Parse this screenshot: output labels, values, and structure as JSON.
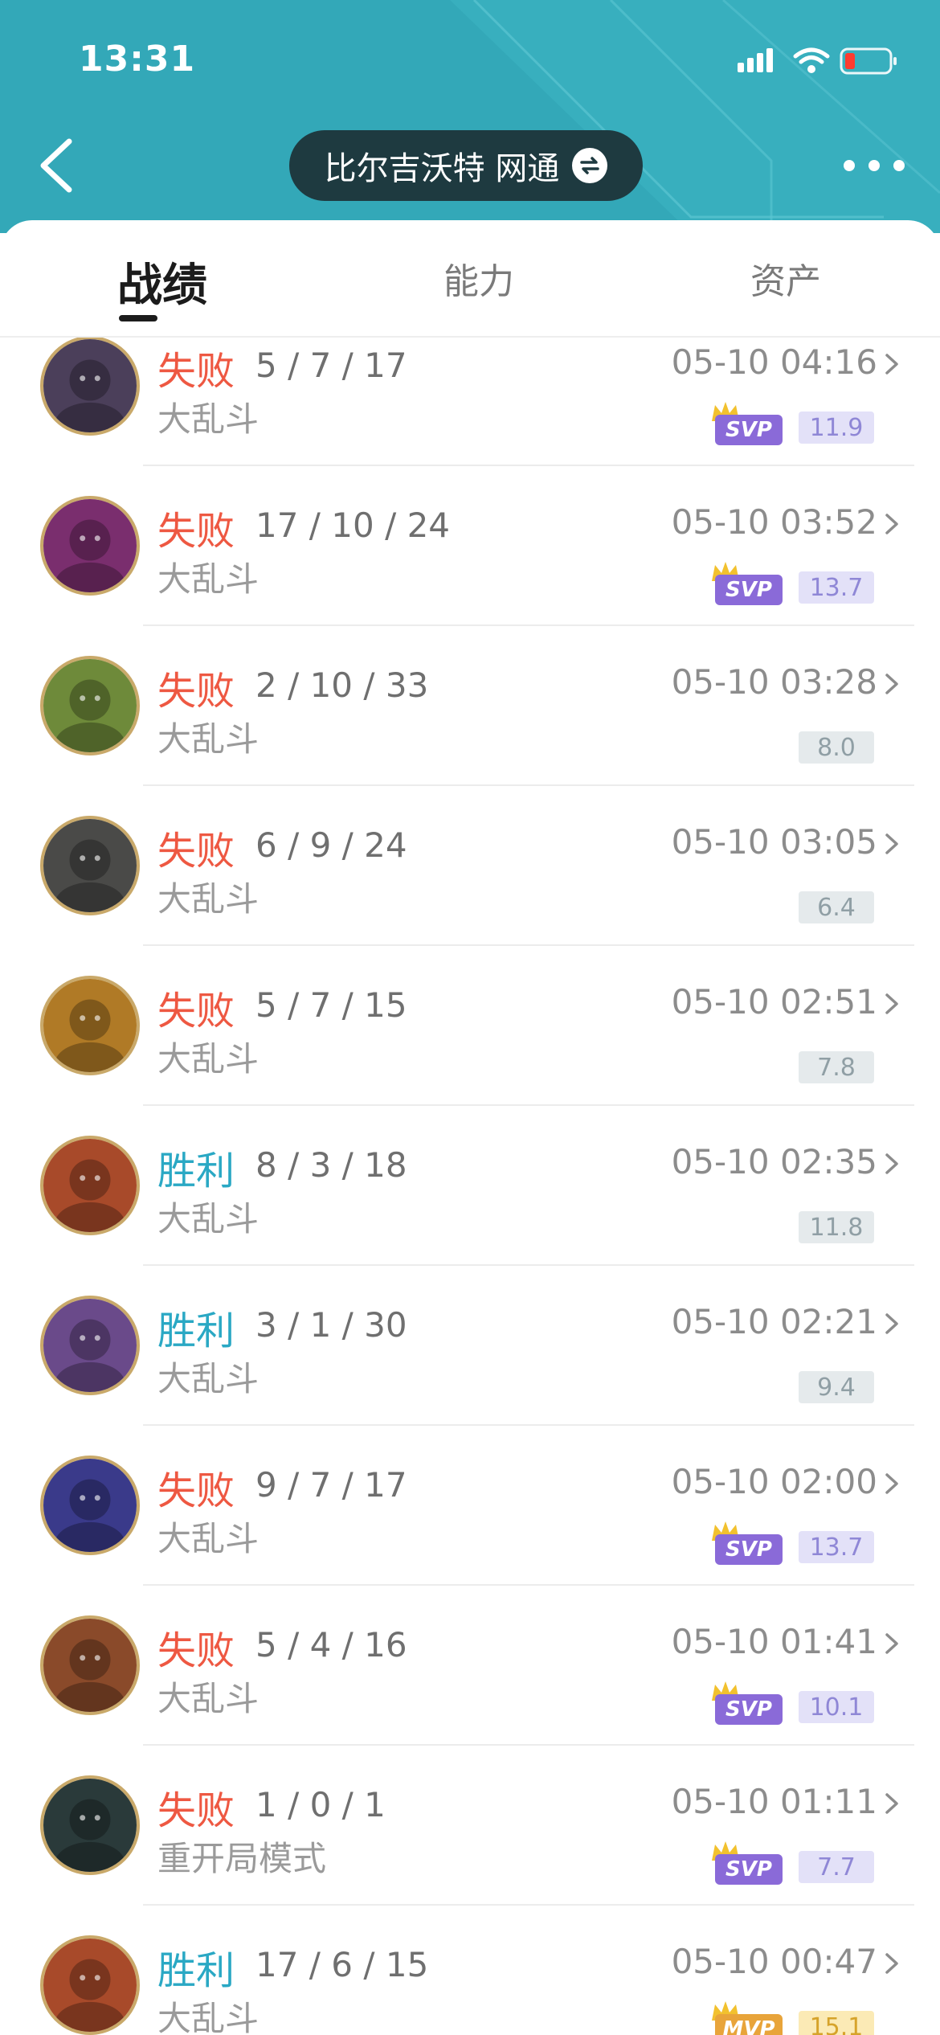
{
  "status_bar": {
    "time": "13:31"
  },
  "header": {
    "server": "比尔吉沃特 网通",
    "colors": {
      "bg": "#33a8b8",
      "pill": "#1e3a40"
    }
  },
  "tabs": [
    {
      "label": "战绩",
      "active": true
    },
    {
      "label": "能力",
      "active": false
    },
    {
      "label": "资产",
      "active": false
    }
  ],
  "colors": {
    "lose": "#ee5842",
    "win": "#2aa8c4"
  },
  "matches": [
    {
      "result": "失败",
      "outcome": "lose",
      "kda": "5 / 7 / 17",
      "mode": "大乱斗",
      "time": "05-10 04:16",
      "badge": "SVP",
      "score": "11.9",
      "avatar_color": "#4b3f5a",
      "avatar_icon": "champion-portrait"
    },
    {
      "result": "失败",
      "outcome": "lose",
      "kda": "17 / 10 / 24",
      "mode": "大乱斗",
      "time": "05-10 03:52",
      "badge": "SVP",
      "score": "13.7",
      "avatar_color": "#7a2e6e",
      "avatar_icon": "champion-portrait"
    },
    {
      "result": "失败",
      "outcome": "lose",
      "kda": "2 / 10 / 33",
      "mode": "大乱斗",
      "time": "05-10 03:28",
      "badge": "",
      "score": "8.0",
      "avatar_color": "#6e8a3a",
      "avatar_icon": "champion-portrait"
    },
    {
      "result": "失败",
      "outcome": "lose",
      "kda": "6 / 9 / 24",
      "mode": "大乱斗",
      "time": "05-10 03:05",
      "badge": "",
      "score": "6.4",
      "avatar_color": "#4a4a48",
      "avatar_icon": "champion-portrait"
    },
    {
      "result": "失败",
      "outcome": "lose",
      "kda": "5 / 7 / 15",
      "mode": "大乱斗",
      "time": "05-10 02:51",
      "badge": "",
      "score": "7.8",
      "avatar_color": "#b07a26",
      "avatar_icon": "champion-portrait"
    },
    {
      "result": "胜利",
      "outcome": "win",
      "kda": "8 / 3 / 18",
      "mode": "大乱斗",
      "time": "05-10 02:35",
      "badge": "",
      "score": "11.8",
      "avatar_color": "#a84a2a",
      "avatar_icon": "champion-portrait"
    },
    {
      "result": "胜利",
      "outcome": "win",
      "kda": "3 / 1 / 30",
      "mode": "大乱斗",
      "time": "05-10 02:21",
      "badge": "",
      "score": "9.4",
      "avatar_color": "#6a4a8a",
      "avatar_icon": "champion-portrait"
    },
    {
      "result": "失败",
      "outcome": "lose",
      "kda": "9 / 7 / 17",
      "mode": "大乱斗",
      "time": "05-10 02:00",
      "badge": "SVP",
      "score": "13.7",
      "avatar_color": "#3a3a8a",
      "avatar_icon": "champion-portrait"
    },
    {
      "result": "失败",
      "outcome": "lose",
      "kda": "5 / 4 / 16",
      "mode": "大乱斗",
      "time": "05-10 01:41",
      "badge": "SVP",
      "score": "10.1",
      "avatar_color": "#8a4a2a",
      "avatar_icon": "champion-portrait"
    },
    {
      "result": "失败",
      "outcome": "lose",
      "kda": "1 / 0 / 1",
      "mode": "重开局模式",
      "time": "05-10 01:11",
      "badge": "SVP",
      "score": "7.7",
      "avatar_color": "#2a3a3a",
      "avatar_icon": "champion-portrait"
    },
    {
      "result": "胜利",
      "outcome": "win",
      "kda": "17 / 6 / 15",
      "mode": "大乱斗",
      "time": "05-10 00:47",
      "badge": "MVP",
      "score": "15.1",
      "avatar_color": "#a84a2a",
      "avatar_icon": "champion-portrait"
    }
  ]
}
